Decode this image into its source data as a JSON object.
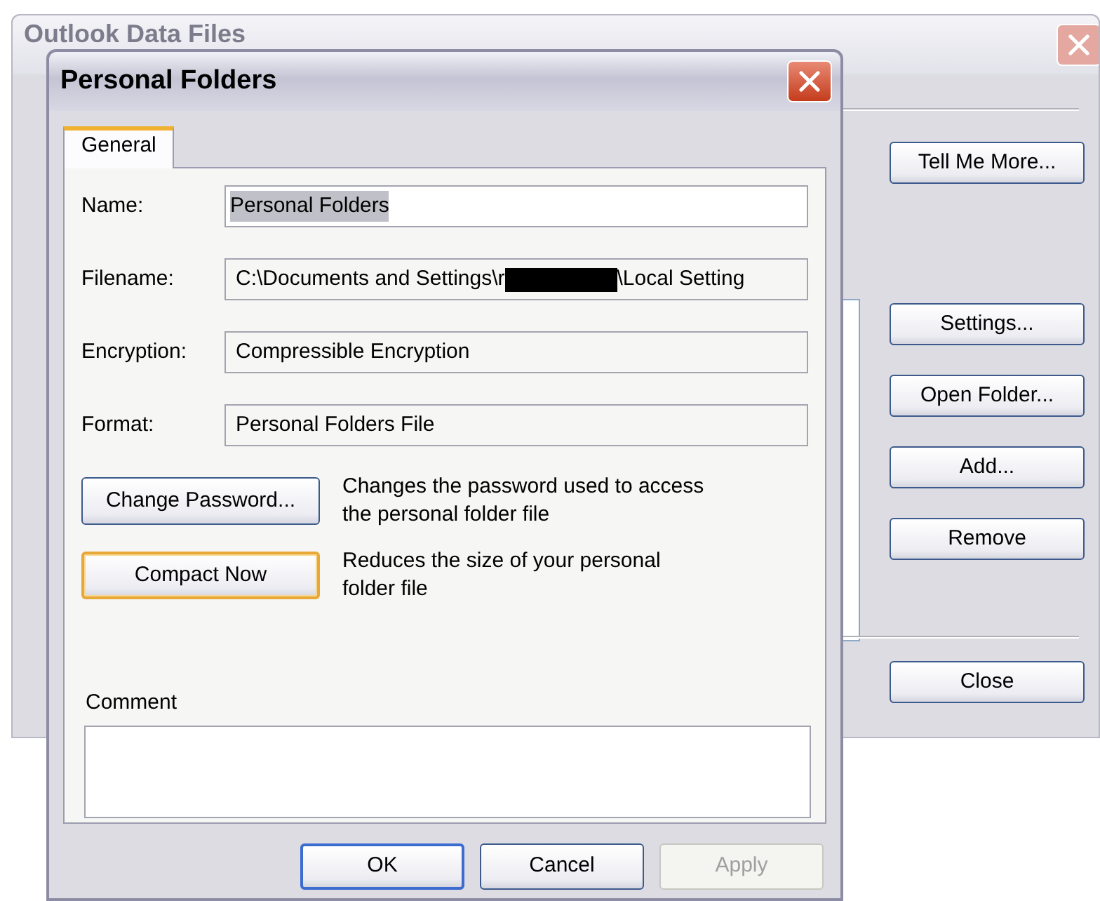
{
  "background_window": {
    "title": "Outlook Data Files",
    "side_buttons": [
      {
        "label": "Tell Me More..."
      },
      {
        "label": "Settings..."
      },
      {
        "label": "Open Folder..."
      },
      {
        "label": "Add..."
      },
      {
        "label": "Remove"
      }
    ],
    "close_button": "Close"
  },
  "dialog": {
    "title": "Personal Folders",
    "tabs": [
      {
        "label": "General",
        "selected": true
      }
    ],
    "fields": [
      {
        "label": "Name:",
        "kind": "editable",
        "value": "Personal Folders",
        "selected": true
      },
      {
        "label": "Filename:",
        "kind": "readonly",
        "value": "C:\\Documents and Settings\\r",
        "selected": false,
        "redacted": true,
        "value_after": "\\Local Setting"
      },
      {
        "label": "Encryption:",
        "kind": "readonly",
        "value": "Compressible Encryption",
        "selected": false
      },
      {
        "label": "Format:",
        "kind": "readonly",
        "value": "Personal Folders File",
        "selected": false
      }
    ],
    "actions": [
      {
        "button": "Change Password...",
        "description": "Changes the password used to access the personal folder file",
        "focused": false
      },
      {
        "button": "Compact Now",
        "description": "Reduces the size of your personal folder file",
        "focused": true
      }
    ],
    "comment": {
      "label": "Comment"
    },
    "buttons": [
      {
        "label": "OK",
        "default": true,
        "disabled": false
      },
      {
        "label": "Cancel",
        "default": false,
        "disabled": false
      },
      {
        "label": "Apply",
        "default": false,
        "disabled": true
      }
    ]
  }
}
